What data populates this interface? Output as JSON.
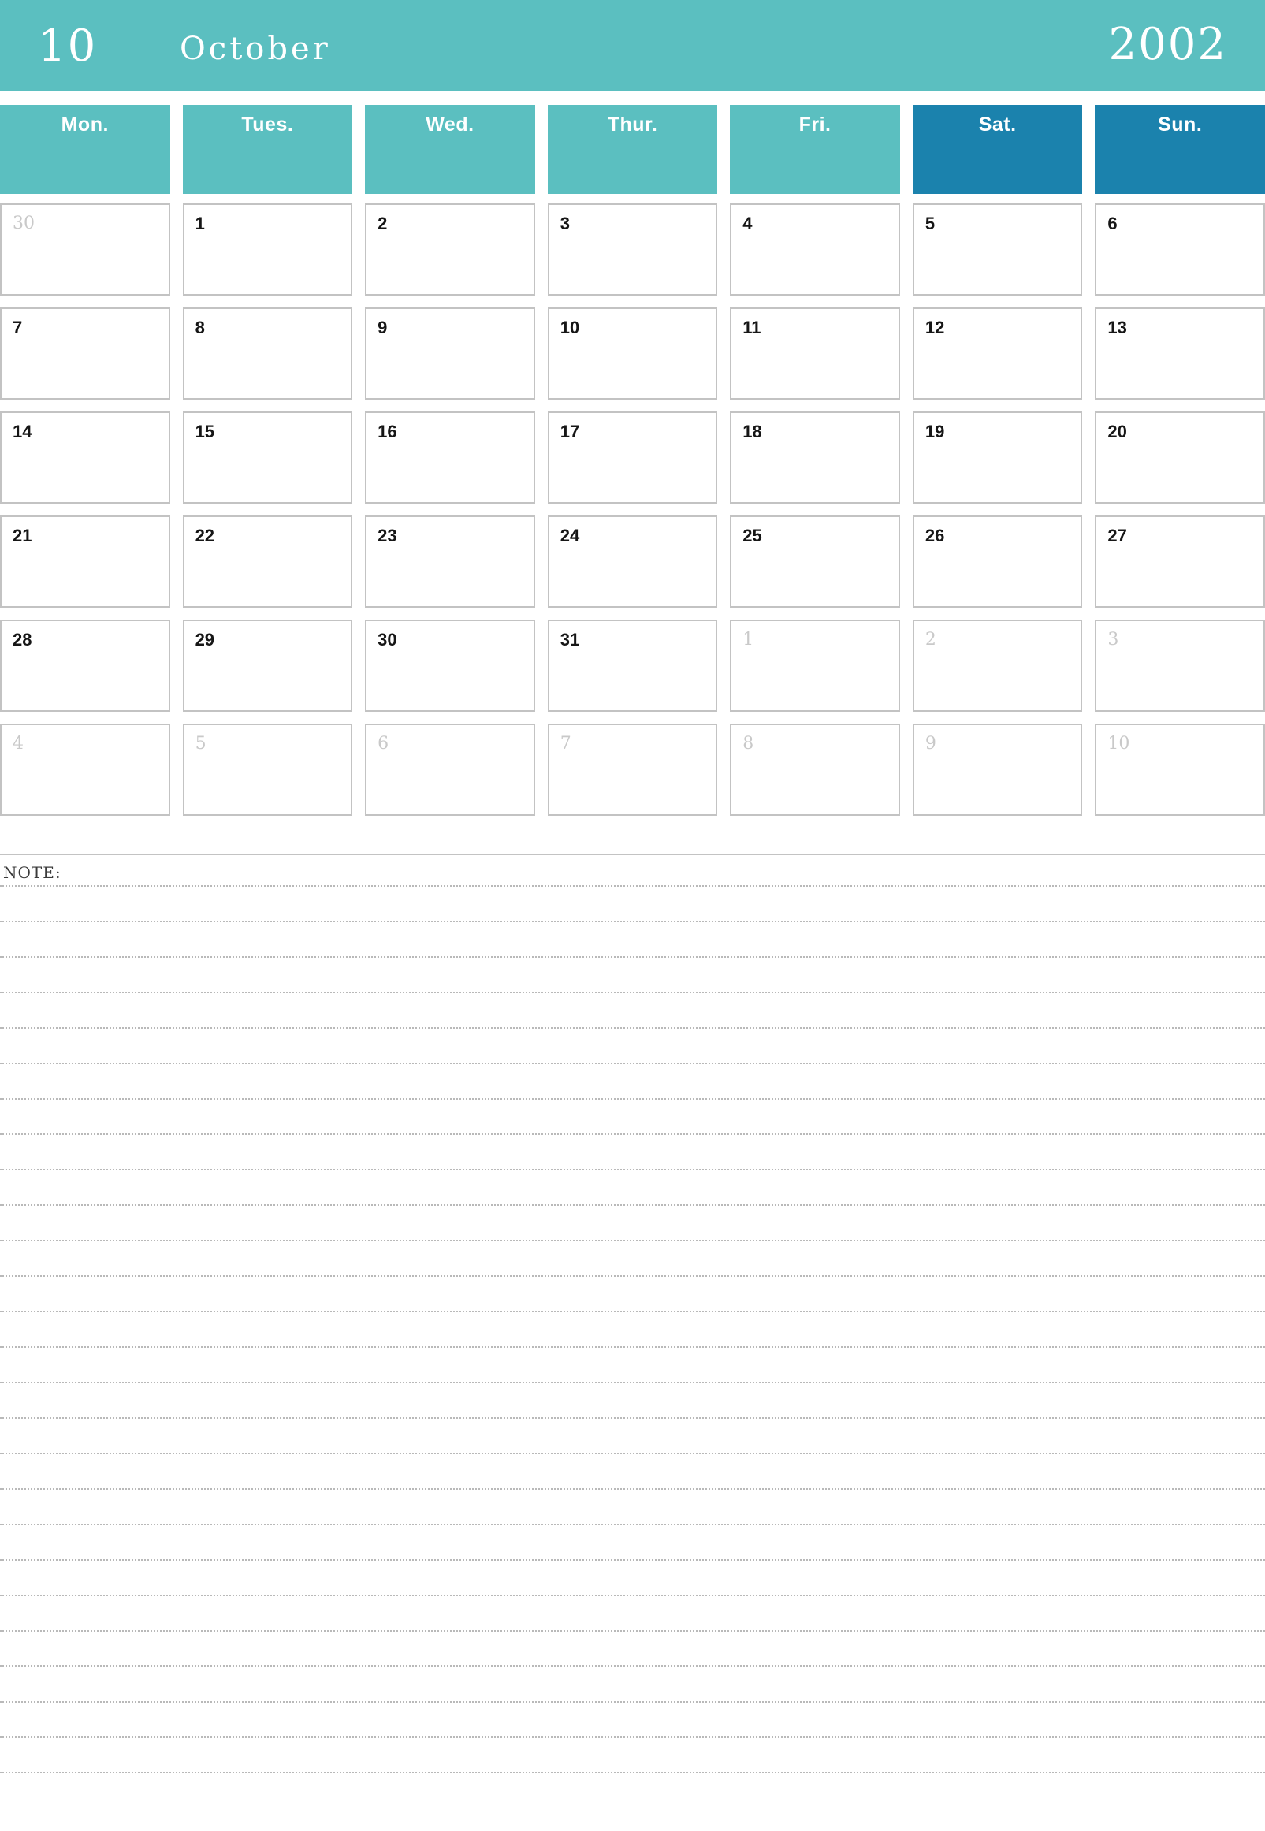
{
  "header": {
    "month_number": "10",
    "month_name": "October",
    "year": "2002",
    "bg_color": "#5bbfc0",
    "text_color": "#ffffff"
  },
  "weekdays": [
    {
      "label": "Mon.",
      "weekend": false,
      "color": "#5bbfc0"
    },
    {
      "label": "Tues.",
      "weekend": false,
      "color": "#5bbfc0"
    },
    {
      "label": "Wed.",
      "weekend": false,
      "color": "#5bbfc0"
    },
    {
      "label": "Thur.",
      "weekend": false,
      "color": "#5bbfc0"
    },
    {
      "label": "Fri.",
      "weekend": false,
      "color": "#5bbfc0"
    },
    {
      "label": "Sat.",
      "weekend": true,
      "color": "#1b82ad"
    },
    {
      "label": "Sun.",
      "weekend": true,
      "color": "#1b82ad"
    }
  ],
  "grid": {
    "rows": 6,
    "columns": 7,
    "border_color": "#c3c3c3",
    "current_month_color": "#161616",
    "adjacent_month_color": "#c9c9c9",
    "cells": [
      {
        "num": "30",
        "adjacent": true
      },
      {
        "num": "1",
        "adjacent": false
      },
      {
        "num": "2",
        "adjacent": false
      },
      {
        "num": "3",
        "adjacent": false
      },
      {
        "num": "4",
        "adjacent": false
      },
      {
        "num": "5",
        "adjacent": false
      },
      {
        "num": "6",
        "adjacent": false
      },
      {
        "num": "7",
        "adjacent": false
      },
      {
        "num": "8",
        "adjacent": false
      },
      {
        "num": "9",
        "adjacent": false
      },
      {
        "num": "10",
        "adjacent": false
      },
      {
        "num": "11",
        "adjacent": false
      },
      {
        "num": "12",
        "adjacent": false
      },
      {
        "num": "13",
        "adjacent": false
      },
      {
        "num": "14",
        "adjacent": false
      },
      {
        "num": "15",
        "adjacent": false
      },
      {
        "num": "16",
        "adjacent": false
      },
      {
        "num": "17",
        "adjacent": false
      },
      {
        "num": "18",
        "adjacent": false
      },
      {
        "num": "19",
        "adjacent": false
      },
      {
        "num": "20",
        "adjacent": false
      },
      {
        "num": "21",
        "adjacent": false
      },
      {
        "num": "22",
        "adjacent": false
      },
      {
        "num": "23",
        "adjacent": false
      },
      {
        "num": "24",
        "adjacent": false
      },
      {
        "num": "25",
        "adjacent": false
      },
      {
        "num": "26",
        "adjacent": false
      },
      {
        "num": "27",
        "adjacent": false
      },
      {
        "num": "28",
        "adjacent": false
      },
      {
        "num": "29",
        "adjacent": false
      },
      {
        "num": "30",
        "adjacent": false
      },
      {
        "num": "31",
        "adjacent": false
      },
      {
        "num": "1",
        "adjacent": true
      },
      {
        "num": "2",
        "adjacent": true
      },
      {
        "num": "3",
        "adjacent": true
      },
      {
        "num": "4",
        "adjacent": true
      },
      {
        "num": "5",
        "adjacent": true
      },
      {
        "num": "6",
        "adjacent": true
      },
      {
        "num": "7",
        "adjacent": true
      },
      {
        "num": "8",
        "adjacent": true
      },
      {
        "num": "9",
        "adjacent": true
      },
      {
        "num": "10",
        "adjacent": true
      }
    ]
  },
  "note": {
    "label": "NOTE:",
    "line_count": 26,
    "line_color": "#b9b9b9"
  }
}
